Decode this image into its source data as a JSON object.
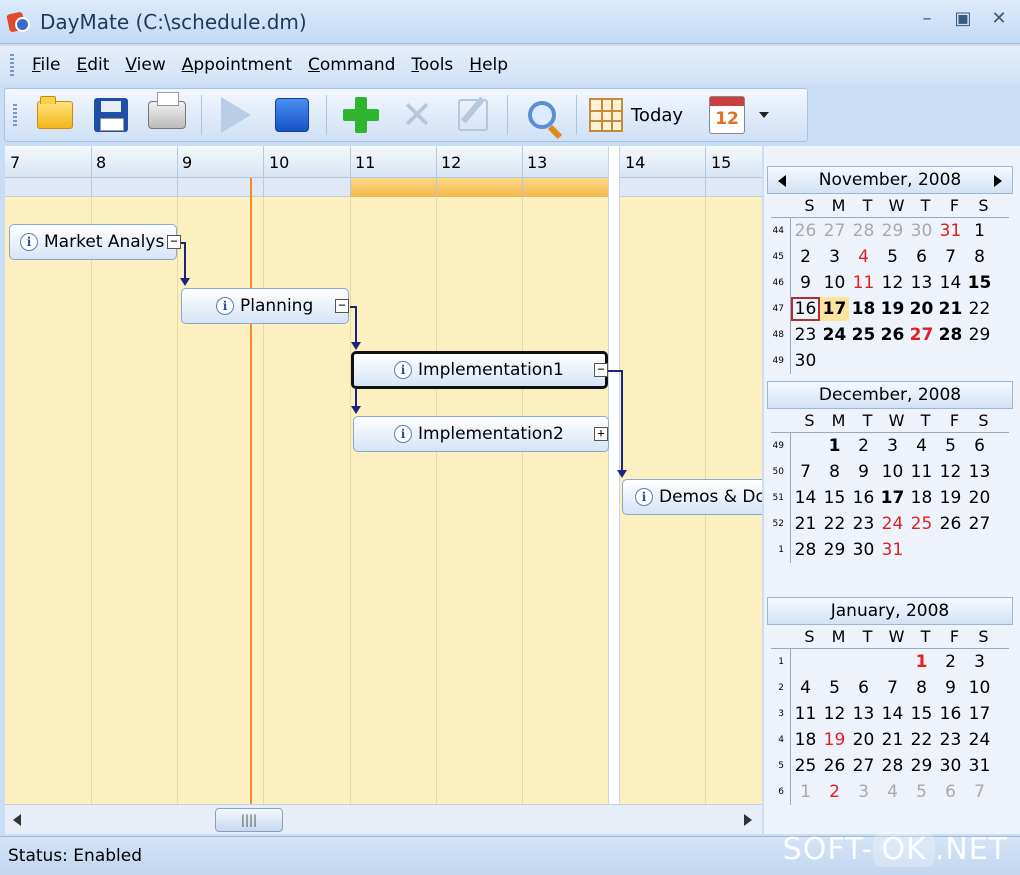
{
  "window": {
    "title": "DayMate (C:\\schedule.dm)",
    "controls": [
      "–",
      "▣",
      "✕"
    ]
  },
  "menu": [
    {
      "label": "File",
      "accel": "F",
      "rest": "ile"
    },
    {
      "label": "Edit",
      "accel": "E",
      "rest": "dit"
    },
    {
      "label": "View",
      "accel": "V",
      "rest": "iew"
    },
    {
      "label": "Appointment",
      "accel": "A",
      "rest": "ppointment"
    },
    {
      "label": "Command",
      "accel": "C",
      "rest": "ommand"
    },
    {
      "label": "Tools",
      "accel": "T",
      "rest": "ools"
    },
    {
      "label": "Help",
      "accel": "H",
      "rest": "elp"
    }
  ],
  "toolbar": {
    "today_label": "Today",
    "calendar_icon_text": "12"
  },
  "gantt": {
    "columns": [
      "7",
      "8",
      "9",
      "10",
      "11",
      "12",
      "13",
      "14",
      "15"
    ],
    "tasks": [
      {
        "label": "Market Analys",
        "expander": "−"
      },
      {
        "label": "Planning",
        "expander": "−"
      },
      {
        "label": "Implementation1",
        "expander": "−"
      },
      {
        "label": "Implementation2",
        "expander": "+"
      },
      {
        "label": "Demos & Do",
        "expander": ""
      }
    ],
    "scroll_thumb_grip": "||||"
  },
  "calendar": {
    "dow": [
      "S",
      "M",
      "T",
      "W",
      "T",
      "F",
      "S"
    ],
    "months": [
      {
        "title": "November, 2008",
        "weeks": [
          {
            "wk": "44",
            "days": [
              [
                "26",
                "gray"
              ],
              [
                "27",
                "gray"
              ],
              [
                "28",
                "gray"
              ],
              [
                "29",
                "gray"
              ],
              [
                "30",
                "gray"
              ],
              [
                "31",
                "red"
              ],
              [
                "1",
                ""
              ]
            ]
          },
          {
            "wk": "45",
            "days": [
              [
                "2",
                ""
              ],
              [
                "3",
                ""
              ],
              [
                "4",
                "red"
              ],
              [
                "5",
                ""
              ],
              [
                "6",
                ""
              ],
              [
                "7",
                ""
              ],
              [
                "8",
                ""
              ]
            ]
          },
          {
            "wk": "46",
            "days": [
              [
                "9",
                ""
              ],
              [
                "10",
                ""
              ],
              [
                "11",
                "red"
              ],
              [
                "12",
                ""
              ],
              [
                "13",
                ""
              ],
              [
                "14",
                ""
              ],
              [
                "15",
                "bold"
              ]
            ]
          },
          {
            "wk": "47",
            "days": [
              [
                "16",
                "today"
              ],
              [
                "17",
                "bold selected"
              ],
              [
                "18",
                "bold"
              ],
              [
                "19",
                "bold"
              ],
              [
                "20",
                "bold"
              ],
              [
                "21",
                "bold"
              ],
              [
                "22",
                ""
              ]
            ]
          },
          {
            "wk": "48",
            "days": [
              [
                "23",
                ""
              ],
              [
                "24",
                "bold"
              ],
              [
                "25",
                "bold"
              ],
              [
                "26",
                "bold"
              ],
              [
                "27",
                "bold red"
              ],
              [
                "28",
                "bold"
              ],
              [
                "29",
                ""
              ]
            ]
          },
          {
            "wk": "49",
            "days": [
              [
                "30",
                ""
              ],
              [
                "",
                ""
              ],
              [
                "",
                ""
              ],
              [
                "",
                ""
              ],
              [
                "",
                ""
              ],
              [
                "",
                ""
              ],
              [
                "",
                ""
              ]
            ]
          }
        ]
      },
      {
        "title": "December, 2008",
        "weeks": [
          {
            "wk": "49",
            "days": [
              [
                "",
                ""
              ],
              [
                "1",
                "bold"
              ],
              [
                "2",
                ""
              ],
              [
                "3",
                ""
              ],
              [
                "4",
                ""
              ],
              [
                "5",
                ""
              ],
              [
                "6",
                ""
              ]
            ]
          },
          {
            "wk": "50",
            "days": [
              [
                "7",
                ""
              ],
              [
                "8",
                ""
              ],
              [
                "9",
                ""
              ],
              [
                "10",
                ""
              ],
              [
                "11",
                ""
              ],
              [
                "12",
                ""
              ],
              [
                "13",
                ""
              ]
            ]
          },
          {
            "wk": "51",
            "days": [
              [
                "14",
                ""
              ],
              [
                "15",
                ""
              ],
              [
                "16",
                ""
              ],
              [
                "17",
                "bold"
              ],
              [
                "18",
                ""
              ],
              [
                "19",
                ""
              ],
              [
                "20",
                ""
              ]
            ]
          },
          {
            "wk": "52",
            "days": [
              [
                "21",
                ""
              ],
              [
                "22",
                ""
              ],
              [
                "23",
                ""
              ],
              [
                "24",
                "red"
              ],
              [
                "25",
                "red"
              ],
              [
                "26",
                ""
              ],
              [
                "27",
                ""
              ]
            ]
          },
          {
            "wk": "1",
            "days": [
              [
                "28",
                ""
              ],
              [
                "29",
                ""
              ],
              [
                "30",
                ""
              ],
              [
                "31",
                "red"
              ],
              [
                "",
                ""
              ],
              [
                "",
                ""
              ],
              [
                "",
                ""
              ]
            ]
          }
        ]
      },
      {
        "title": "January, 2008",
        "weeks": [
          {
            "wk": "1",
            "days": [
              [
                "",
                ""
              ],
              [
                "",
                ""
              ],
              [
                "",
                ""
              ],
              [
                "",
                ""
              ],
              [
                "1",
                "bold red"
              ],
              [
                "2",
                ""
              ],
              [
                "3",
                ""
              ]
            ]
          },
          {
            "wk": "2",
            "days": [
              [
                "4",
                ""
              ],
              [
                "5",
                ""
              ],
              [
                "6",
                ""
              ],
              [
                "7",
                ""
              ],
              [
                "8",
                ""
              ],
              [
                "9",
                ""
              ],
              [
                "10",
                ""
              ]
            ]
          },
          {
            "wk": "3",
            "days": [
              [
                "11",
                ""
              ],
              [
                "12",
                ""
              ],
              [
                "13",
                ""
              ],
              [
                "14",
                ""
              ],
              [
                "15",
                ""
              ],
              [
                "16",
                ""
              ],
              [
                "17",
                ""
              ]
            ]
          },
          {
            "wk": "4",
            "days": [
              [
                "18",
                ""
              ],
              [
                "19",
                "red"
              ],
              [
                "20",
                ""
              ],
              [
                "21",
                ""
              ],
              [
                "22",
                ""
              ],
              [
                "23",
                ""
              ],
              [
                "24",
                ""
              ]
            ]
          },
          {
            "wk": "5",
            "days": [
              [
                "25",
                ""
              ],
              [
                "26",
                ""
              ],
              [
                "27",
                ""
              ],
              [
                "28",
                ""
              ],
              [
                "29",
                ""
              ],
              [
                "30",
                ""
              ],
              [
                "31",
                ""
              ]
            ]
          },
          {
            "wk": "6",
            "days": [
              [
                "1",
                "gray"
              ],
              [
                "2",
                "red"
              ],
              [
                "3",
                "gray"
              ],
              [
                "4",
                "gray"
              ],
              [
                "5",
                "gray"
              ],
              [
                "6",
                "gray"
              ],
              [
                "7",
                "gray"
              ]
            ]
          }
        ]
      }
    ]
  },
  "status": {
    "text": "Status: Enabled"
  },
  "watermark": {
    "pre": "SOFT-",
    "ok": "OK",
    "post": ".NET"
  }
}
